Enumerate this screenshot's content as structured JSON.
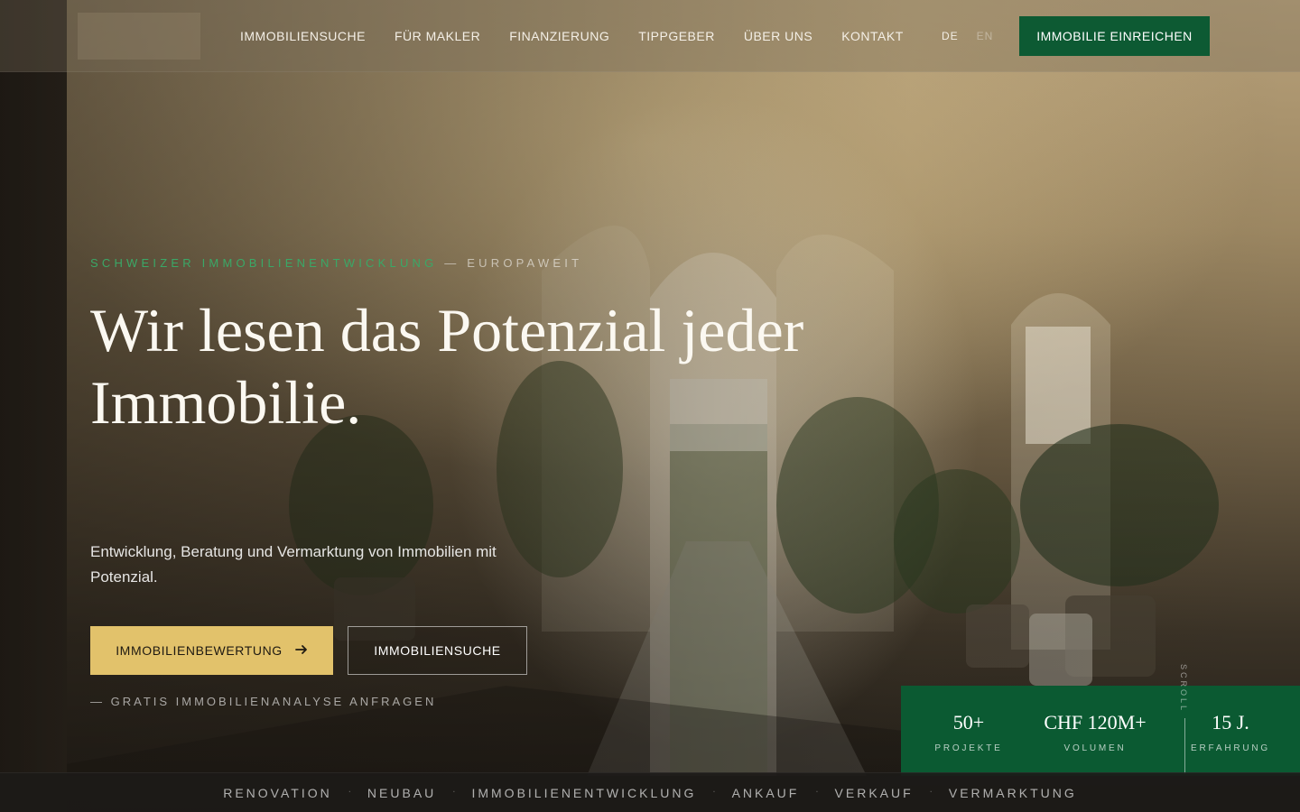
{
  "header": {
    "nav": [
      "IMMOBILIENSUCHE",
      "FÜR MAKLER",
      "FINANZIERUNG",
      "TIPPGEBER",
      "ÜBER UNS",
      "KONTAKT"
    ],
    "lang_active": "DE",
    "lang_inactive": "EN",
    "cta": "IMMOBILIE EINREICHEN"
  },
  "hero": {
    "eyebrow_primary": "SCHWEIZER IMMOBILIENENTWICKLUNG",
    "eyebrow_separator": " — ",
    "eyebrow_secondary": "EUROPAWEIT",
    "headline": "Wir lesen das Potenzial jeder Immobilie.",
    "subtitle": "Entwicklung, Beratung und Vermarktung von Immobilien mit Potenzial.",
    "btn_primary": "IMMOBILIENBEWERTUNG",
    "btn_secondary": "IMMOBILIENSUCHE",
    "link_analysis": "— GRATIS IMMOBILIENANALYSE ANFRAGEN"
  },
  "stats": [
    {
      "value": "50+",
      "label": "PROJEKTE"
    },
    {
      "value": "CHF 120M+",
      "label": "VOLUMEN"
    },
    {
      "value": "15 J.",
      "label": "ERFAHRUNG"
    }
  ],
  "scroll_label": "SCROLL",
  "ticker": [
    "RENOVATION",
    "NEUBAU",
    "IMMOBILIENENTWICKLUNG",
    "ANKAUF",
    "VERKAUF",
    "VERMARKTUNG"
  ],
  "ticker_separator": "·",
  "colors": {
    "brand_green": "#0d5a33",
    "accent_gold": "#e2c26b",
    "eyebrow_green": "#3aa867"
  }
}
